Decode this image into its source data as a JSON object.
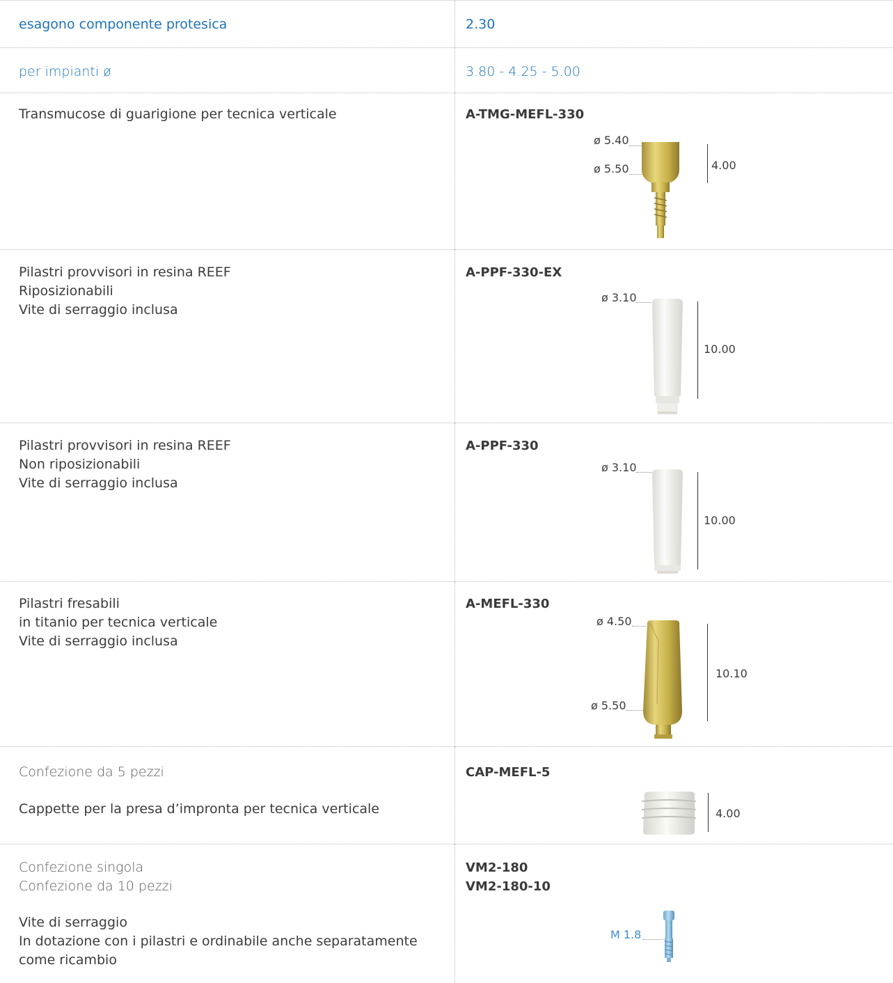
{
  "header": {
    "hex_label": "esagono componente protesica",
    "hex_value": "2.30",
    "implant_label": "per impianti ø",
    "implant_value": "3.80 - 4.25 - 5.00"
  },
  "products": [
    {
      "lines": [
        "Transmucose di guarigione per tecnica verticale"
      ],
      "codes": [
        "A-TMG-MEFL-330"
      ],
      "dims": {
        "d1": "ø 5.40",
        "d2": "ø 5.50",
        "h": "4.00"
      }
    },
    {
      "lines": [
        "Pilastri provvisori in resina REEF",
        "Riposizionabili",
        "Vite di serraggio inclusa"
      ],
      "codes": [
        "A-PPF-330-EX"
      ],
      "dims": {
        "d1": "ø 3.10",
        "h": "10.00"
      }
    },
    {
      "lines": [
        "Pilastri provvisori in resina REEF",
        "Non riposizionabili",
        "Vite di serraggio inclusa"
      ],
      "codes": [
        "A-PPF-330"
      ],
      "dims": {
        "d1": "ø 3.10",
        "h": "10.00"
      }
    },
    {
      "lines": [
        "Pilastri fresabili",
        "in titanio per tecnica verticale",
        "Vite di serraggio inclusa"
      ],
      "codes": [
        "A-MEFL-330"
      ],
      "dims": {
        "d1": "ø 4.50",
        "d2": "ø 5.50",
        "h": "10.10"
      }
    },
    {
      "pack": [
        "Confezione da 5 pezzi"
      ],
      "lines": [
        "Cappette per la presa d’impronta per tecnica verticale"
      ],
      "codes": [
        "CAP-MEFL-5"
      ],
      "dims": {
        "h": "4.00"
      }
    },
    {
      "pack": [
        "Confezione singola",
        "Confezione da 10 pezzi"
      ],
      "lines": [
        "Vite di serraggio",
        "In dotazione con i pilastri e ordinabile anche separatamente",
        "come ricambio"
      ],
      "codes": [
        "VM2-180",
        "VM2-180-10"
      ],
      "dims": {
        "thread": "M 1.8"
      }
    }
  ],
  "colors": {
    "accent": "#1d73b8",
    "gold": "#c9b24a",
    "white_part": "#f2f2ee",
    "screw": "#8fc3e6"
  }
}
